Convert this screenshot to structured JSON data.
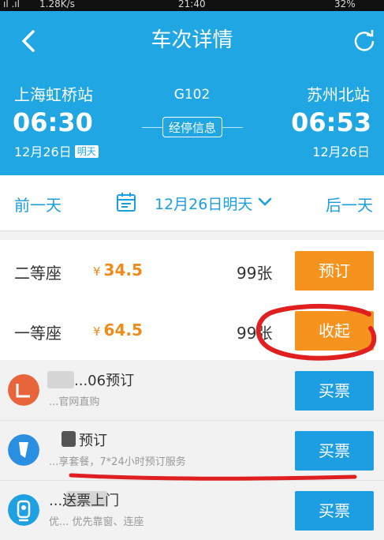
{
  "status_bar": {
    "signal": "ıl .ıl",
    "speed": "1.28K/s",
    "time": "21:40",
    "battery": "32%"
  },
  "header": {
    "title": "车次详情",
    "from": {
      "station": "上海虹桥站",
      "time": "06:30",
      "date": "12月26日",
      "badge": "明天"
    },
    "to": {
      "station": "苏州北站",
      "time": "06:53",
      "date": "12月26日"
    },
    "train_no": "G102",
    "stop_info": "经停信息"
  },
  "datebar": {
    "prev": "前一天",
    "selected": "12月26日明天",
    "next": "后一天"
  },
  "seats": [
    {
      "name": "二等座",
      "yen": "¥",
      "price": "34.5",
      "count": "99张",
      "button": "预订"
    },
    {
      "name": "一等座",
      "yen": "¥",
      "price": "64.5",
      "count": "99张",
      "button": "收起"
    }
  ],
  "agents": [
    {
      "name": "...06预订",
      "desc": "...官网直购",
      "button": "买票",
      "logo_color": "#e8643a"
    },
    {
      "name": "预订",
      "desc": "...享套餐，7*24小时预订服务",
      "button": "买票",
      "logo_color": "#2a8fe0"
    },
    {
      "name": "...送票上门",
      "desc": "优... 优先靠窗、连座",
      "button": "买票",
      "logo_color": "#1fa0e0"
    }
  ],
  "colors": {
    "header_bg": "#20a6e3",
    "orange": "#f5931e",
    "blue_button": "#1d9ee2",
    "annotation_red": "#e02020"
  },
  "icons": [
    "back-arrow-icon",
    "refresh-icon",
    "calendar-icon",
    "chevron-down-icon"
  ]
}
